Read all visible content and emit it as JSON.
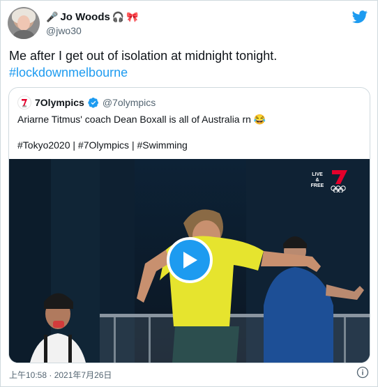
{
  "tweet": {
    "author": {
      "name": "Jo Woods",
      "handle": "@jwo30",
      "name_emojis": [
        "🎤",
        "🎧",
        "🎀"
      ]
    },
    "text": "Me after I get out of isolation at midnight tonight.",
    "hashtag": "#lockdownmelbourne",
    "timestamp": "上午10:58 · 2021年7月26日"
  },
  "quoted_tweet": {
    "name": "7Olympics",
    "handle": "@7olympics",
    "verified": true,
    "text": "Ariarne Titmus' coach Dean Boxall is all of Australia rn 😂",
    "tags": "#Tokyo2020 | #7Olympics | #Swimming",
    "video_badge": {
      "line1": "LIVE &",
      "line2": "FREE",
      "channel": "7"
    }
  },
  "icons": {
    "twitter": "twitter-bird-icon",
    "verified": "verified-badge-icon",
    "play": "play-icon",
    "info": "info-icon"
  },
  "colors": {
    "accent": "#1d9bf0",
    "text": "#0f1419",
    "secondary": "#536471",
    "border": "#cfd9de",
    "channel_red": "#e4002b"
  }
}
